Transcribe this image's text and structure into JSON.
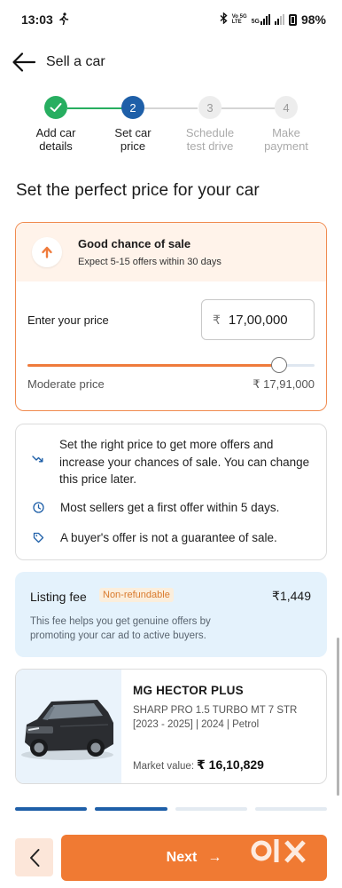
{
  "status_bar": {
    "time": "13:03",
    "net_top": "Vo 5G",
    "net_bottom": "LTE",
    "network": "5G",
    "battery": "98%"
  },
  "header": {
    "title": "Sell a car"
  },
  "stepper": {
    "steps": [
      {
        "number": "",
        "label": "Add car\ndetails",
        "state": "done"
      },
      {
        "number": "2",
        "label": "Set car\nprice",
        "state": "active"
      },
      {
        "number": "3",
        "label": "Schedule\ntest drive",
        "state": "pending"
      },
      {
        "number": "4",
        "label": "Make\npayment",
        "state": "pending"
      }
    ]
  },
  "page_title": "Set the perfect price for your car",
  "price_card": {
    "status_title": "Good chance of sale",
    "status_subtitle": "Expect 5-15 offers within 30 days",
    "enter_label": "Enter your price",
    "currency_symbol": "₹",
    "price_value": "17,00,000",
    "slider_fraction": 0.875,
    "moderate_label": "Moderate price",
    "moderate_value": "₹ 17,91,000"
  },
  "info": {
    "items": [
      {
        "icon": "trend-down-icon",
        "text": "Set the right price to get more offers and increase your chances of sale. You can change this price later."
      },
      {
        "icon": "clock-icon",
        "text": "Most sellers get a first offer within 5 days."
      },
      {
        "icon": "tag-icon",
        "text": "A buyer's offer is not a guarantee of sale."
      }
    ]
  },
  "fee": {
    "title": "Listing fee",
    "badge": "Non-refundable",
    "amount": "₹1,449",
    "description": "This fee helps you get genuine offers by promoting your car ad to active buyers."
  },
  "car": {
    "name": "MG HECTOR PLUS",
    "variant": "SHARP PRO 1.5 TURBO MT 7 STR [2023 - 2025] | 2024 | Petrol",
    "market_label": "Market value:",
    "market_value": "₹ 16,10,829"
  },
  "progress": {
    "segments_filled": 2,
    "segments_total": 4
  },
  "footer": {
    "next_label": "Next",
    "next_arrow": "→"
  },
  "watermark": "olx",
  "colors": {
    "accent": "#f07a33",
    "done_green": "#27ae60",
    "active_blue": "#1e5fa8",
    "progress_dark": "#1e5fa8"
  }
}
